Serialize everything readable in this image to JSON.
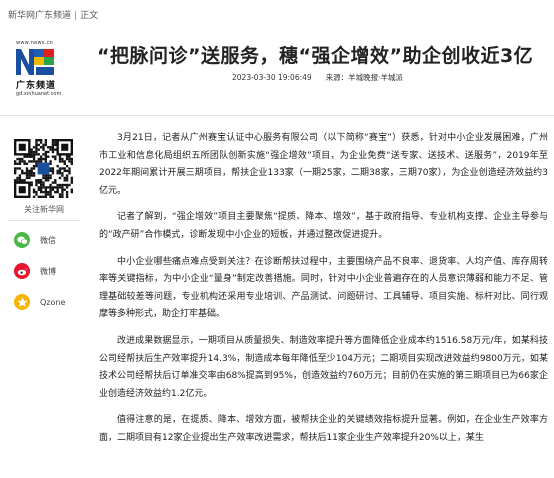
{
  "breadcrumb": {
    "site": "新华网广东频道",
    "separator": "|",
    "current": "正文"
  },
  "logo": {
    "url_text": "www.news.cn",
    "brand_cn": "广东频道",
    "sub_url": "gd.xinhuanet.com"
  },
  "article": {
    "title": "“把脉问诊”送服务，穗“强企增效”助企创收近3亿",
    "date": "2023-03-30 19:06:49",
    "source": "来源：羊城晚报·羊城派",
    "paragraphs": [
      "3月21日，记者从广州赛宝认证中心服务有限公司（以下简称“赛宝”）获悉，针对中小企业发展困难，广州市工业和信息化局组织五所团队创新实施“强企增效”项目，为企业免费“送专家、送技术、送服务”，2019年至2022年期间累计开展三期项目，帮扶企业133家（一期25家，二期38家，三期70家），为企业创造经济效益约3亿元。",
      "记者了解到，“强企增效”项目主要聚焦“提质、降本、增效”，基于政府指导、专业机构支撑、企业主导参与的“政产研”合作模式，诊断发现中小企业的短板，并通过整改促进提升。",
      "中小企业哪些痛点难点受到关注？在诊断帮扶过程中，主要围绕产品不良率、退货率、人均产值、库存周转率等关键指标，为中小企业“量身”制定改善措施。同时，针对中小企业普遍存在的人员意识薄弱和能力不足、管理基础较差等问题，专业机构还采用专业培训、产品测试、问题研讨、工具辅导、项目实施、标杆对比、同行观摩等多种形式，助企打牢基础。",
      "改进成果数据显示，一期项目从质量损失、制造效率提升等方面降低企业成本约1516.58万元/年，如某科技公司经帮扶后生产效率提升14.3%，制造成本每年降低至少104万元；二期项目实现改进效益约9800万元，如某技术公司经帮扶后订单准交率由68%提高到95%，创造效益约760万元；目前仍在实施的第三期项目已为66家企业创造经济效益约1.2亿元。",
      "值得注意的是，在提质、降本、增效方面，被帮扶企业的关键绩效指标提升显著。例如，在企业生产效率方面，二期项目有12家企业提出生产效率改进需求，帮扶后11家企业生产效率提升20%以上，某生"
    ]
  },
  "sidebar": {
    "follow_label": "关注新华网",
    "share": [
      {
        "label": "微信",
        "icon": "wechat-icon",
        "color": "#4cb84a"
      },
      {
        "label": "微博",
        "icon": "weibo-icon",
        "color": "#e6162d"
      },
      {
        "label": "Qzone",
        "icon": "qzone-icon",
        "color": "#f7b500"
      }
    ]
  }
}
